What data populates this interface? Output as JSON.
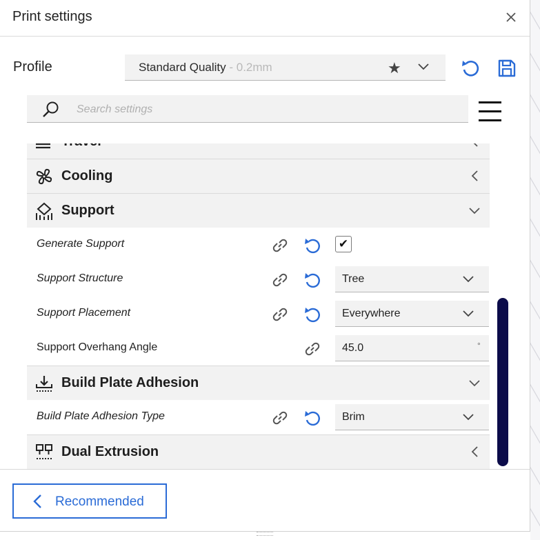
{
  "window": {
    "title": "Print settings"
  },
  "profile": {
    "label": "Profile",
    "name": "Standard Quality",
    "sub": " - 0.2mm"
  },
  "search": {
    "placeholder": "Search settings"
  },
  "categories": {
    "travel": {
      "label": "Travel"
    },
    "cooling": {
      "label": "Cooling"
    },
    "support": {
      "label": "Support"
    },
    "adhesion": {
      "label": "Build Plate Adhesion"
    },
    "dual": {
      "label": "Dual Extrusion"
    }
  },
  "settings": {
    "generate_support": {
      "label": "Generate Support",
      "checked_glyph": "✔"
    },
    "support_structure": {
      "label": "Support Structure",
      "value": "Tree"
    },
    "support_placement": {
      "label": "Support Placement",
      "value": "Everywhere"
    },
    "overhang_angle": {
      "label": "Support Overhang Angle",
      "value": "45.0",
      "unit": "°"
    },
    "adhesion_type": {
      "label": "Build Plate Adhesion Type",
      "value": "Brim"
    }
  },
  "footer": {
    "recommended_label": "Recommended"
  },
  "colors": {
    "accent": "#2a6bd6",
    "scrollbar": "#0c0c4a",
    "field_bg": "#f2f2f2"
  }
}
